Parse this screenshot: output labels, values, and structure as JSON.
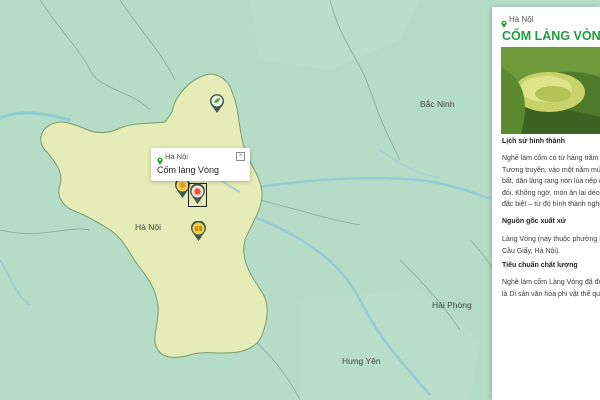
{
  "map": {
    "places": {
      "hanoi": "Hà Nội",
      "bac_ninh": "Bắc Ninh",
      "hai_phong": "Hải Phòng",
      "hung_yen": "Hưng Yên"
    }
  },
  "popup": {
    "location": "Hà Nội",
    "title": "Cốm làng Vòng",
    "close": "×"
  },
  "panel": {
    "location": "Hà Nội",
    "title": "CỐM LÀNG VÒNG",
    "section1_title": "Lịch sử hình thành",
    "section1_text": "Nghề làm cốm có từ hàng trăm n\nTương truyền, vào một năm mùa\nbất, dân làng rang non lúa nếp đ\nđói. Không ngờ, món ăn lại dẻo, t\nđặc biệt – từ đó hình thành nghề",
    "section2_title": "Nguồn gốc xuất xứ",
    "section2_text": "Làng Vòng (nay thuộc phường Dị\nCầu Giấy, Hà Nội).",
    "section3_title": "Tiêu chuẩn chất lượng",
    "section3_text": "Nghề làm cốm Làng Vòng đã đư\nlà Di sản văn hóa phi vật thể quố"
  },
  "colors": {
    "water": "#a9d6c6",
    "land": "#b3dcc6",
    "hanoi_region": "#e6ecb7",
    "accent_green": "#239a3e"
  }
}
